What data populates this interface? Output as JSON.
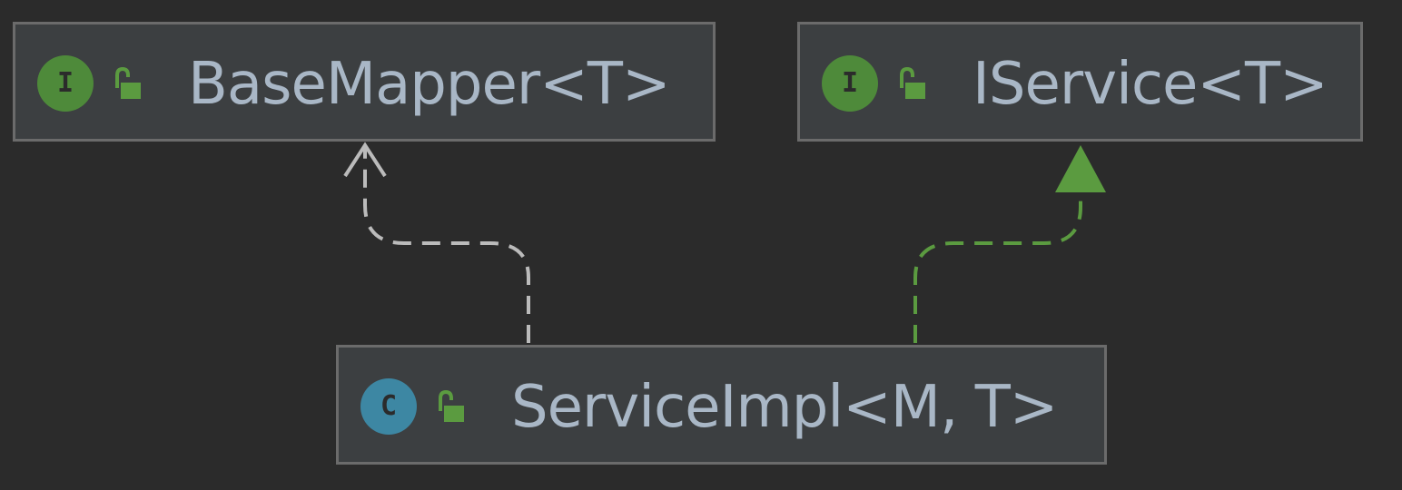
{
  "diagram": {
    "nodes": {
      "base_mapper": {
        "kind": "interface",
        "kind_letter": "I",
        "label": "BaseMapper<T>"
      },
      "iservice": {
        "kind": "interface",
        "kind_letter": "I",
        "label": "IService<T>"
      },
      "service_impl": {
        "kind": "class",
        "kind_letter": "C",
        "label": "ServiceImpl<M, T>"
      }
    },
    "edges": [
      {
        "from": "service_impl",
        "to": "base_mapper",
        "type": "dependency"
      },
      {
        "from": "service_impl",
        "to": "iservice",
        "type": "realization"
      }
    ]
  },
  "colors": {
    "background": "#2b2b2b",
    "node_fill": "#3c3f41",
    "node_border": "#6b6b6b",
    "label_text": "#a9b7c6",
    "interface_icon": "#4e8a3a",
    "class_icon": "#3d87a3",
    "access_lock": "#5b9b40",
    "dependency_edge": "#bbbbbb",
    "realization_edge": "#5b9b40"
  },
  "icons": {
    "interface": "interface-badge-icon",
    "class": "class-badge-icon",
    "access": "public-unlocked-lock-icon"
  }
}
